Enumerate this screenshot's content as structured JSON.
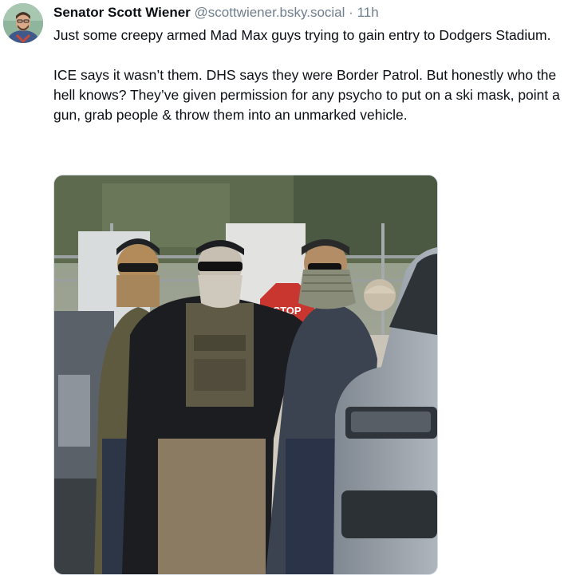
{
  "post": {
    "author_name": "Senator Scott Wiener",
    "handle": "@scottwiener.bsky.social",
    "time_separator": "·",
    "timestamp": "11h",
    "paragraphs": [
      "Just some creepy armed Mad Max guys trying to gain entry to Dodgers Stadium.",
      "ICE says it wasn’t them. DHS says they were Border Patrol. But honestly who the hell knows? They’ve given permission for any psycho to put on a ski mask, point a gun, grab people & throw them into an unmarked vehicle."
    ],
    "photo": {
      "sign_text": "STOP"
    }
  },
  "colors": {
    "text_primary": "#0b0f14",
    "text_secondary": "#6f7e8c",
    "image_border": "#d4dbe2"
  }
}
